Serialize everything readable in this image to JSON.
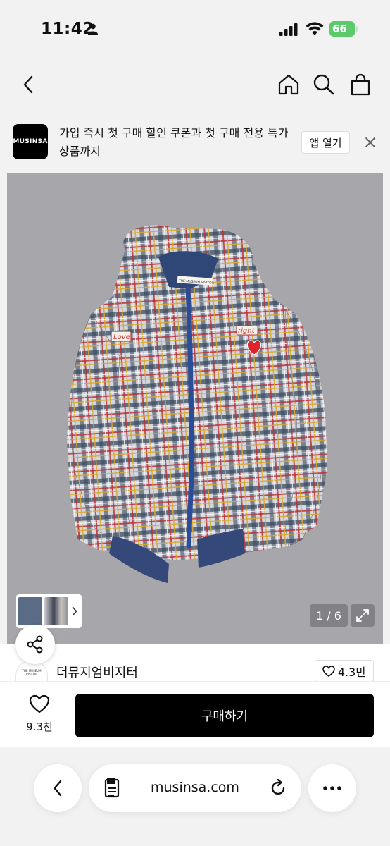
{
  "status_bar": {
    "time": "11:42",
    "battery": "66"
  },
  "banner": {
    "logo_text": "MUSINSA",
    "message": "가입 즉시 첫 구매 할인 쿠폰과 첫 구매 전용 특가 상품까지",
    "open_app_label": "앱 열기"
  },
  "product_image": {
    "page_counter": "1 / 6",
    "jacket_patch_left": "Love",
    "jacket_patch_right": "right",
    "jacket_label": "THE MUSEUM VISITOR"
  },
  "brand": {
    "avatar_text": "THE MUSEUM VISITOR",
    "name": "더뮤지엄비지터",
    "like_count": "4.3만"
  },
  "purchase": {
    "wish_count": "9.3천",
    "buy_label": "구매하기"
  },
  "browser": {
    "url": "musinsa.com"
  },
  "colors": {
    "battery_green": "#5cc96b",
    "buy_button": "#000000",
    "image_background": "#a7a6aa"
  }
}
